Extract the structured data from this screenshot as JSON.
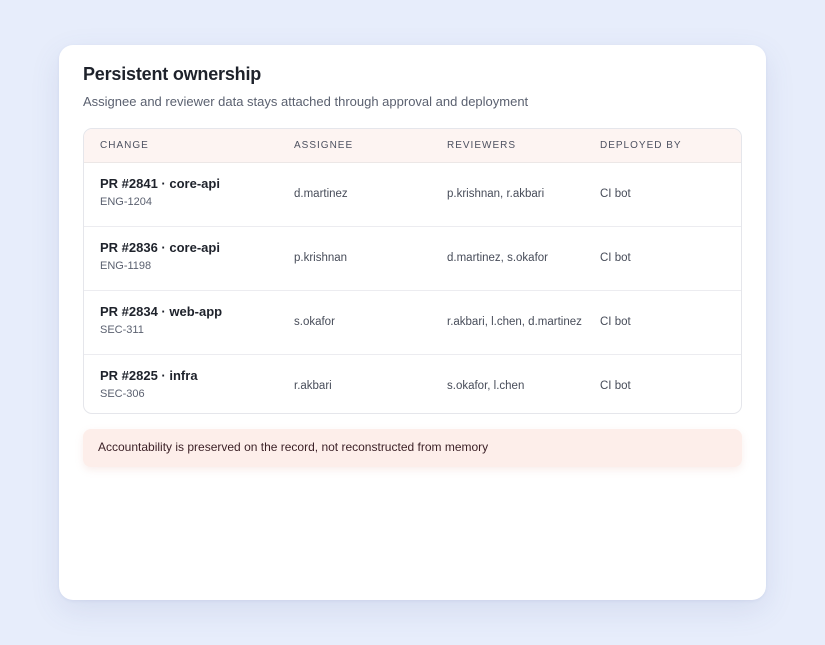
{
  "card": {
    "title": "Persistent ownership",
    "subtitle": "Assignee and reviewer data stays attached through approval and deployment"
  },
  "table": {
    "columns": [
      "CHANGE",
      "ASSIGNEE",
      "REVIEWERS",
      "DEPLOYED BY"
    ],
    "rows": [
      {
        "change": "PR #2841 · core-api",
        "ticket": "ENG-1204",
        "assignee": "d.martinez",
        "reviewers": "p.krishnan, r.akbari",
        "deployed_by": "CI bot"
      },
      {
        "change": "PR #2836 · core-api",
        "ticket": "ENG-1198",
        "assignee": "p.krishnan",
        "reviewers": "d.martinez, s.okafor",
        "deployed_by": "CI bot"
      },
      {
        "change": "PR #2834 · web-app",
        "ticket": "SEC-311",
        "assignee": "s.okafor",
        "reviewers": "r.akbari, l.chen, d.martinez",
        "deployed_by": "CI bot"
      },
      {
        "change": "PR #2825 · infra",
        "ticket": "SEC-306",
        "assignee": "r.akbari",
        "reviewers": "s.okafor, l.chen",
        "deployed_by": "CI bot"
      }
    ]
  },
  "note": {
    "text": "Accountability is preserved on the record, not reconstructed from memory"
  },
  "colors": {
    "background": "#e7edfb",
    "header_tint": "#fdf4f2",
    "note_bg": "#fdeeea"
  }
}
